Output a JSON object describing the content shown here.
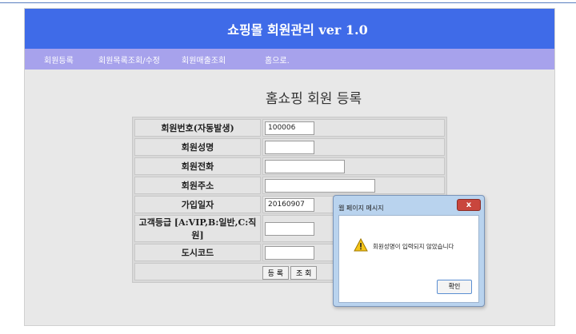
{
  "header": {
    "title": "쇼핑몰 회원관리 ver 1.0"
  },
  "nav": {
    "items": [
      "회원등록",
      "회원목록조회/수정",
      "회원매출조회",
      "홈으로."
    ]
  },
  "page": {
    "title": "홈쇼핑 회원 등록"
  },
  "form": {
    "fields": [
      {
        "label": "회원번호(자동발생)",
        "value": "100006"
      },
      {
        "label": "회원성명",
        "value": ""
      },
      {
        "label": "회원전화",
        "value": ""
      },
      {
        "label": "회원주소",
        "value": ""
      },
      {
        "label": "가입일자",
        "value": "20160907"
      },
      {
        "label": "고객등급 [A:VIP,B:일반,C:직원]",
        "value": ""
      },
      {
        "label": "도시코드",
        "value": ""
      }
    ],
    "submit_label": "등 록",
    "query_label": "조 회"
  },
  "dialog": {
    "title": "웹 페이지 메시지",
    "close_label": "x",
    "message": "회원성명이 입력되지 않았습니다",
    "ok_label": "확인"
  }
}
